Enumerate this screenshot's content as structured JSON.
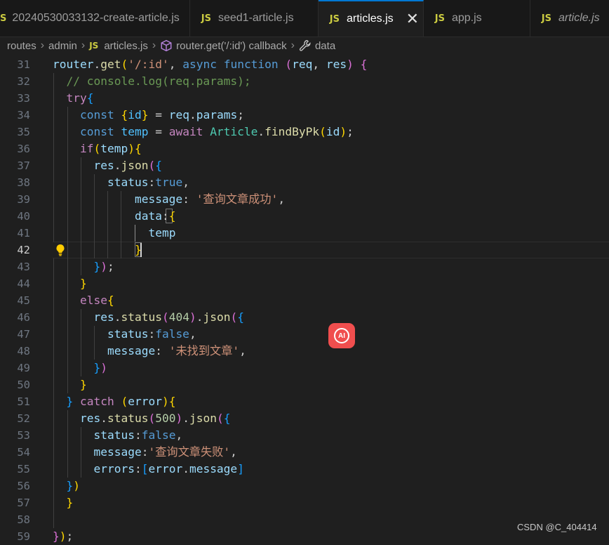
{
  "tabs": [
    {
      "label": "20240530033132-create-article.js",
      "badge": "S",
      "active": false,
      "italic": false
    },
    {
      "label": "seed1-article.js",
      "badge": "JS",
      "active": false,
      "italic": false
    },
    {
      "label": "articles.js",
      "badge": "JS",
      "active": true,
      "italic": false,
      "close": "✕"
    },
    {
      "label": "app.js",
      "badge": "JS",
      "active": false,
      "italic": false
    },
    {
      "label": "article.js",
      "badge": "JS",
      "active": false,
      "italic": true
    }
  ],
  "breadcrumb": {
    "items": [
      "routes",
      "admin",
      "articles.js",
      "router.get('/:id') callback",
      "data"
    ],
    "js_badge": "JS",
    "separator": "›"
  },
  "editor": {
    "current_line": 42,
    "line_numbers": [
      "31",
      "32",
      "33",
      "34",
      "35",
      "36",
      "37",
      "38",
      "39",
      "40",
      "41",
      "42",
      "43",
      "44",
      "45",
      "46",
      "47",
      "48",
      "49",
      "50",
      "51",
      "52",
      "53",
      "54",
      "55",
      "56",
      "57",
      "58",
      "59"
    ],
    "line_texts": [
      "router.get('/:id', async function (req, res) {",
      "  // console.log(req.params);",
      "  try{",
      "    const {id} = req.params;",
      "    const temp = await Article.findByPk(id);",
      "    if(temp){",
      "      res.json({",
      "        status:true,",
      "            message: '查询文章成功',",
      "            data:{",
      "              temp",
      "            }",
      "      });",
      "    }",
      "    else{",
      "      res.status(404).json({",
      "        status:false,",
      "        message: '未找到文章',",
      "      })",
      "    }",
      "  } catch (error){",
      "    res.status(500).json({",
      "      status:false,",
      "      message:'查询文章失败',",
      "      errors:[error.message]",
      "  })",
      "  }",
      "",
      "});"
    ]
  },
  "ai_button": {
    "label": "AI"
  },
  "watermark": "CSDN @C_404414",
  "colors": {
    "background": "#1f1f1f",
    "keyword": "#569cd6",
    "control": "#c586c0",
    "function": "#dcdcaa",
    "variable": "#9cdcfe",
    "string": "#ce9178",
    "comment": "#6a9955",
    "accent": "#0078d4",
    "js_badge": "#cbcb41",
    "ai_button": "#f04e4e"
  },
  "icons": [
    "js-icon",
    "cube-icon",
    "wrench-icon",
    "lightbulb-icon",
    "close-icon",
    "ai-assistant-icon"
  ]
}
